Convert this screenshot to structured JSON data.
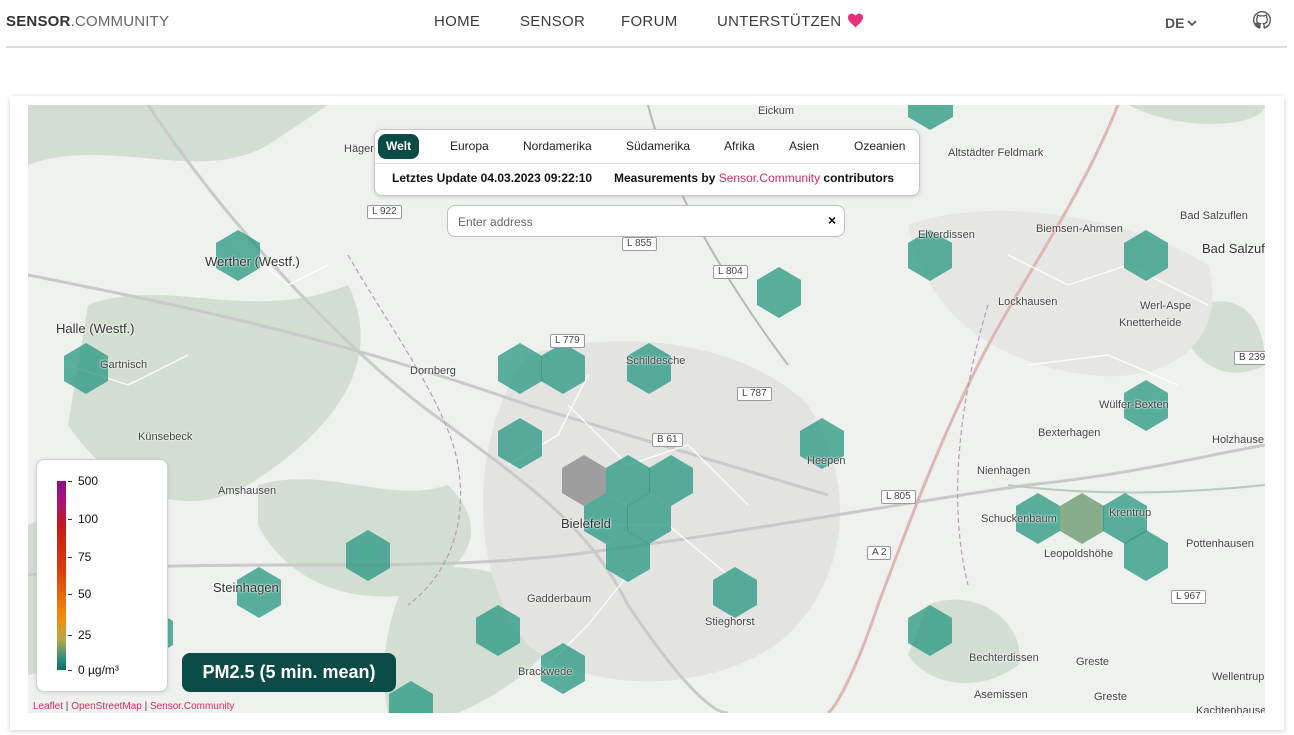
{
  "header": {
    "logo_bold": "SENSOR",
    "logo_thin": ".COMMUNITY",
    "nav": [
      {
        "label": "HOME"
      },
      {
        "label": "SENSOR"
      },
      {
        "label": "FORUM"
      },
      {
        "label": "UNTERSTÜTZEN"
      }
    ],
    "language": "DE",
    "accent_heart": "#e8317a"
  },
  "map": {
    "regions": [
      "Welt",
      "Europa",
      "Nordamerika",
      "Südamerika",
      "Afrika",
      "Asien",
      "Ozeanien"
    ],
    "active_region": "Welt",
    "update_text": "Letztes Update 04.03.2023 09:22:10",
    "credit_prefix": "Measurements by ",
    "credit_link": "Sensor.Community",
    "credit_suffix": " contributors",
    "search_placeholder": "Enter address",
    "clear_symbol": "×",
    "badge": "PM2.5 (5 min. mean)",
    "legend": {
      "labels": [
        "500",
        "100",
        "75",
        "50",
        "25",
        "0 µg/m³"
      ]
    },
    "attribution": {
      "leaflet": "Leaflet",
      "osm": "OpenStreetMap",
      "sc": "Sensor.Community",
      "sep": " | "
    },
    "places": [
      {
        "name": "Eickum"
      },
      {
        "name": "Häger"
      },
      {
        "name": "Altstädter Feldmark"
      },
      {
        "name": "Elverdissen"
      },
      {
        "name": "Biemsen-Ahmsen"
      },
      {
        "name": "Bad Salzuflen"
      },
      {
        "name": "Bad Salzuf"
      },
      {
        "name": "Werther (Westf.)"
      },
      {
        "name": "Halle (Westf.)"
      },
      {
        "name": "Gartnisch"
      },
      {
        "name": "Dornberg"
      },
      {
        "name": "Schildesche"
      },
      {
        "name": "Lockhausen"
      },
      {
        "name": "Werl-Aspe"
      },
      {
        "name": "Knetterheide"
      },
      {
        "name": "Wülfer-Bexten"
      },
      {
        "name": "Bexterhagen"
      },
      {
        "name": "Holzhause"
      },
      {
        "name": "Künsebeck"
      },
      {
        "name": "Heepen"
      },
      {
        "name": "Nienhagen"
      },
      {
        "name": "Amshausen"
      },
      {
        "name": "Bielefeld"
      },
      {
        "name": "Schuckenbaum"
      },
      {
        "name": "Krentrup"
      },
      {
        "name": "Leopoldshöhe"
      },
      {
        "name": "Pottenhausen"
      },
      {
        "name": "Steinhagen"
      },
      {
        "name": "Gadderbaum"
      },
      {
        "name": "Stieghorst"
      },
      {
        "name": "Brackwede"
      },
      {
        "name": "Bechterdissen"
      },
      {
        "name": "Greste"
      },
      {
        "name": "Asemissen"
      },
      {
        "name": "Greste"
      },
      {
        "name": "Wellentrup"
      },
      {
        "name": "Kachtenhausen"
      }
    ],
    "roads": [
      "L 922",
      "L 855",
      "L 804",
      "L 779",
      "L 787",
      "B 61",
      "L 805",
      "A 2",
      "L 967",
      "B 239"
    ],
    "hex_colors": {
      "green": "#2e9a84",
      "grey": "#8a8a8a",
      "olive": "#6a9a70"
    }
  }
}
